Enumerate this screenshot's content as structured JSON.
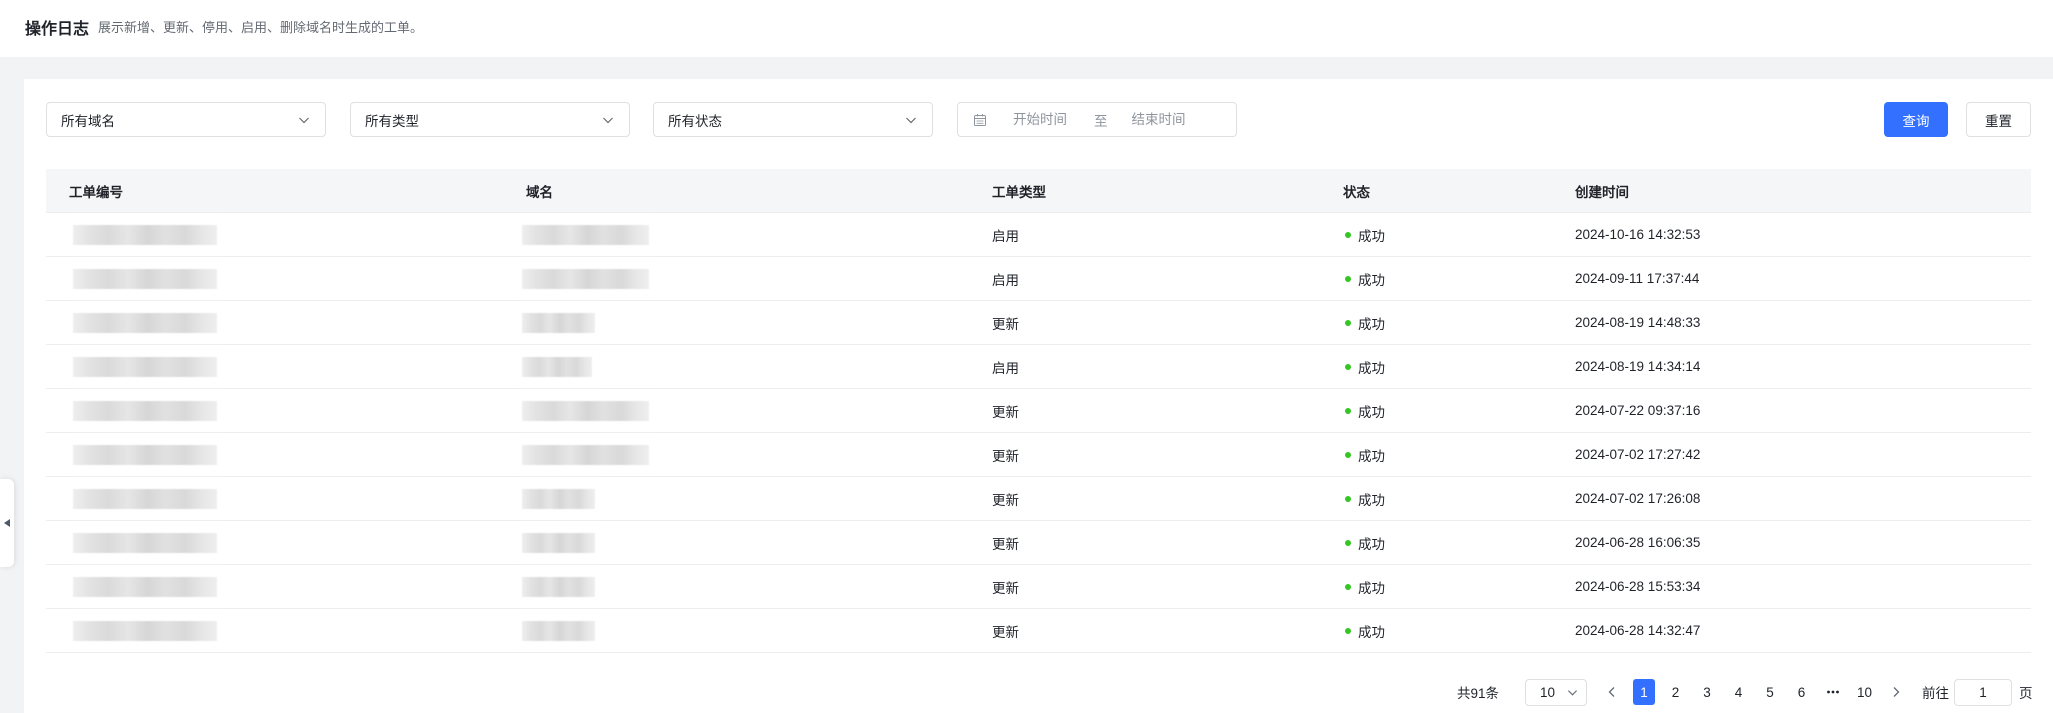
{
  "header": {
    "title": "操作日志",
    "subtitle": "展示新增、更新、停用、启用、删除域名时生成的工单。"
  },
  "filters": {
    "domain_select": "所有域名",
    "type_select": "所有类型",
    "status_select": "所有状态",
    "date_range": {
      "start_placeholder": "开始时间",
      "separator": "至",
      "end_placeholder": "结束时间"
    },
    "query_label": "查询",
    "reset_label": "重置"
  },
  "table": {
    "columns": [
      "工单编号",
      "域名",
      "工单类型",
      "状态",
      "创建时间"
    ],
    "rows": [
      {
        "type": "启用",
        "status": "成功",
        "created": "2024-10-16 14:32:53"
      },
      {
        "type": "启用",
        "status": "成功",
        "created": "2024-09-11 17:37:44"
      },
      {
        "type": "更新",
        "status": "成功",
        "created": "2024-08-19 14:48:33"
      },
      {
        "type": "启用",
        "status": "成功",
        "created": "2024-08-19 14:34:14"
      },
      {
        "type": "更新",
        "status": "成功",
        "created": "2024-07-22 09:37:16"
      },
      {
        "type": "更新",
        "status": "成功",
        "created": "2024-07-02 17:27:42"
      },
      {
        "type": "更新",
        "status": "成功",
        "created": "2024-07-02 17:26:08"
      },
      {
        "type": "更新",
        "status": "成功",
        "created": "2024-06-28 16:06:35"
      },
      {
        "type": "更新",
        "status": "成功",
        "created": "2024-06-28 15:53:34"
      },
      {
        "type": "更新",
        "status": "成功",
        "created": "2024-06-28 14:32:47"
      }
    ]
  },
  "pagination": {
    "total_label": "共91条",
    "page_size": "10",
    "pages": [
      {
        "label": "1",
        "active": true
      },
      {
        "label": "2"
      },
      {
        "label": "3"
      },
      {
        "label": "4"
      },
      {
        "label": "5"
      },
      {
        "label": "6"
      }
    ],
    "last_page": "10",
    "goto_label": "前往",
    "goto_value": "1",
    "goto_suffix": "页"
  },
  "colors": {
    "primary": "#3370ff",
    "success": "#34c724",
    "text": "#1f2329"
  },
  "icons": {
    "select_arrow": "chevron-down-icon",
    "date": "calendar-icon",
    "pager_prev": "chevron-left-icon",
    "pager_next": "chevron-right-icon",
    "pager_more": "ellipsis-icon",
    "status": "status-dot-icon",
    "collapse": "caret-left-icon"
  }
}
